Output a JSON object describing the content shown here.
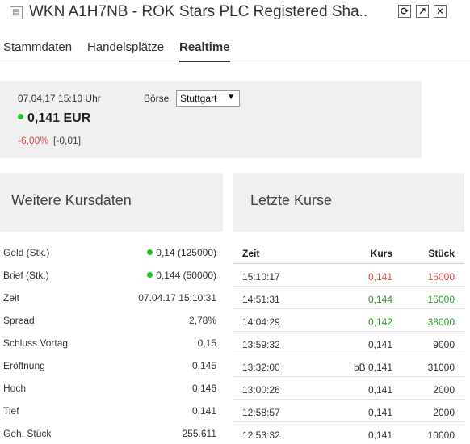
{
  "window": {
    "title": "WKN A1H7NB - ROK Stars PLC Registered Sha..",
    "buttons": {
      "refresh": "⟳",
      "popout": "↗",
      "close": "✕"
    }
  },
  "tabs": [
    {
      "label": "Stammdaten",
      "active": false
    },
    {
      "label": "Handelsplätze",
      "active": false
    },
    {
      "label": "Realtime",
      "active": true
    }
  ],
  "quote": {
    "datetime": "07.04.17  15:10 Uhr",
    "exchange_label": "Börse",
    "exchange_selected": "Stuttgart",
    "price": "0,141 EUR",
    "change_pct": "-6,00%",
    "change_abs": "[-0,01]",
    "status_color": "#1fc51f"
  },
  "sections": {
    "left_title": "Weitere Kursdaten",
    "right_title": "Letzte Kurse"
  },
  "kursdaten": [
    {
      "label": "Geld (Stk.)",
      "value": "0,14 (125000)",
      "dot": true
    },
    {
      "label": "Brief (Stk.)",
      "value": "0,144 (50000)",
      "dot": true
    },
    {
      "label": "Zeit",
      "value": "07.04.17 15:10:31",
      "dot": false
    },
    {
      "label": "Spread",
      "value": "2,78%",
      "dot": false
    },
    {
      "label": "Schluss Vortag",
      "value": "0,15",
      "dot": false
    },
    {
      "label": "Eröffnung",
      "value": "0,145",
      "dot": false
    },
    {
      "label": "Hoch",
      "value": "0,146",
      "dot": false
    },
    {
      "label": "Tief",
      "value": "0,141",
      "dot": false
    },
    {
      "label": "Geh. Stück",
      "value": "255.611",
      "dot": false
    }
  ],
  "letzte_kurse": {
    "headers": {
      "zeit": "Zeit",
      "kurs": "Kurs",
      "stueck": "Stück"
    },
    "rows": [
      {
        "zeit": "15:10:17",
        "kurs": "0,141",
        "stueck": "15000",
        "trend": "red"
      },
      {
        "zeit": "14:51:31",
        "kurs": "0,144",
        "stueck": "15000",
        "trend": "green"
      },
      {
        "zeit": "14:04:29",
        "kurs": "0,142",
        "stueck": "38000",
        "trend": "green"
      },
      {
        "zeit": "13:59:32",
        "kurs": "0,141",
        "stueck": "9000",
        "trend": ""
      },
      {
        "zeit": "13:32:00",
        "kurs": "bB 0,141",
        "stueck": "31000",
        "trend": ""
      },
      {
        "zeit": "13:00:26",
        "kurs": "0,141",
        "stueck": "2000",
        "trend": ""
      },
      {
        "zeit": "12:58:57",
        "kurs": "0,141",
        "stueck": "2000",
        "trend": ""
      },
      {
        "zeit": "12:53:32",
        "kurs": "0,141",
        "stueck": "10000",
        "trend": ""
      }
    ]
  }
}
